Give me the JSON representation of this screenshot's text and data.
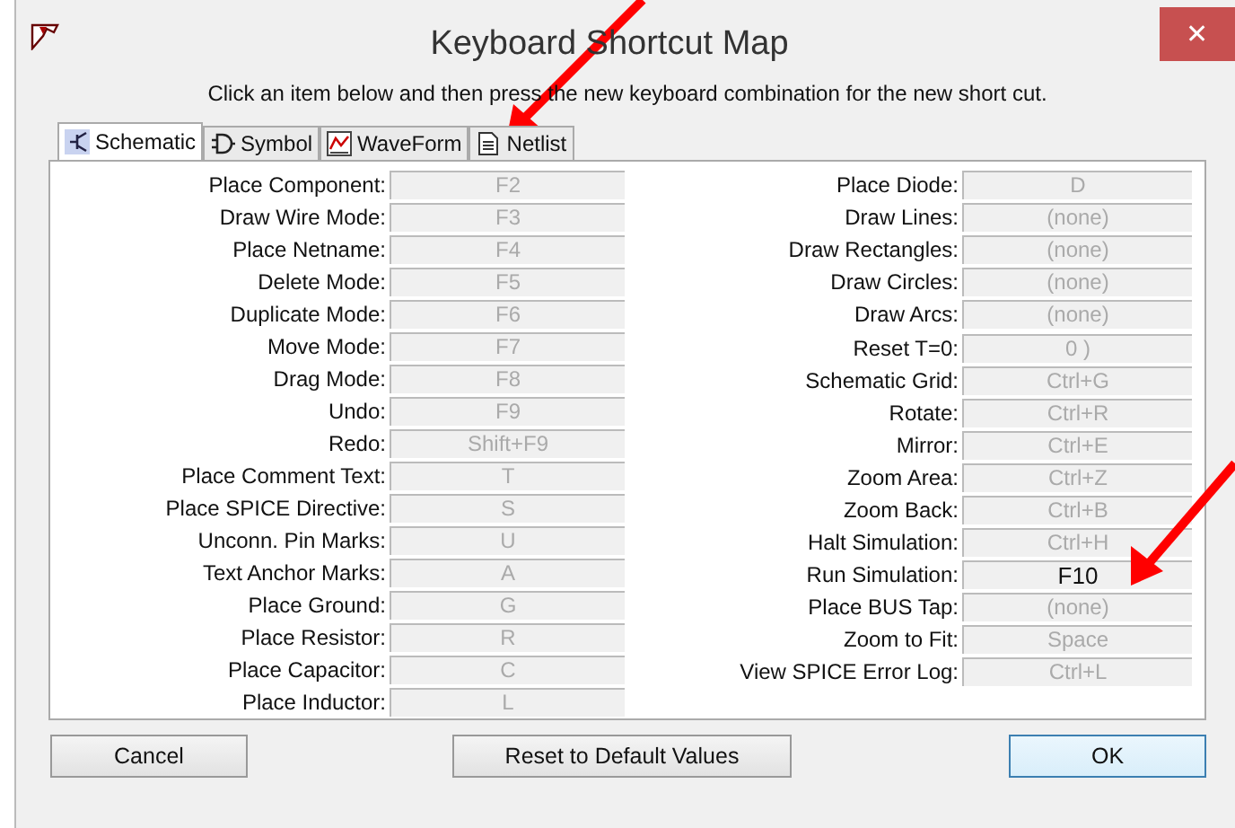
{
  "window": {
    "title": "Keyboard Shortcut Map",
    "close": "✕"
  },
  "instruction": "Click an item below and then press the new keyboard combination for the new short cut.",
  "tabs": [
    {
      "label": "Schematic",
      "selected": true
    },
    {
      "label": "Symbol",
      "selected": false
    },
    {
      "label": "WaveForm",
      "selected": false
    },
    {
      "label": "Netlist",
      "selected": false
    }
  ],
  "columns": [
    [
      {
        "label": "Place Component:",
        "key": "F2",
        "modified": false
      },
      {
        "label": "Draw Wire Mode:",
        "key": "F3",
        "modified": false
      },
      {
        "label": "Place Netname:",
        "key": "F4",
        "modified": false
      },
      {
        "label": "Delete Mode:",
        "key": "F5",
        "modified": false
      },
      {
        "label": "Duplicate Mode:",
        "key": "F6",
        "modified": false
      },
      {
        "label": "Move Mode:",
        "key": "F7",
        "modified": false
      },
      {
        "label": "Drag Mode:",
        "key": "F8",
        "modified": false
      },
      {
        "label": "Undo:",
        "key": "F9",
        "modified": false
      },
      {
        "label": "Redo:",
        "key": "Shift+F9",
        "modified": false
      },
      {
        "label": "Place Comment Text:",
        "key": "T",
        "modified": false
      },
      {
        "label": "Place SPICE Directive:",
        "key": "S",
        "modified": false
      },
      {
        "label": "Unconn. Pin Marks:",
        "key": "U",
        "modified": false
      },
      {
        "label": "Text Anchor Marks:",
        "key": "A",
        "modified": false
      },
      {
        "label": "Place Ground:",
        "key": "G",
        "modified": false
      },
      {
        "label": "Place Resistor:",
        "key": "R",
        "modified": false
      },
      {
        "label": "Place Capacitor:",
        "key": "C",
        "modified": false
      },
      {
        "label": "Place Inductor:",
        "key": "L",
        "modified": false
      }
    ],
    [
      {
        "label": "Place Diode:",
        "key": "D",
        "modified": false
      },
      {
        "label": "Draw Lines:",
        "key": "(none)",
        "modified": false
      },
      {
        "label": "Draw Rectangles:",
        "key": "(none)",
        "modified": false
      },
      {
        "label": "Draw Circles:",
        "key": "(none)",
        "modified": false
      },
      {
        "label": "Draw Arcs:",
        "key": "(none)",
        "modified": false
      },
      {
        "label": "Reset T=0:",
        "key": "0 )",
        "modified": false
      },
      {
        "label": "Schematic Grid:",
        "key": "Ctrl+G",
        "modified": false
      },
      {
        "label": "Rotate:",
        "key": "Ctrl+R",
        "modified": false
      },
      {
        "label": "Mirror:",
        "key": "Ctrl+E",
        "modified": false
      },
      {
        "label": "Zoom Area:",
        "key": "Ctrl+Z",
        "modified": false
      },
      {
        "label": "Zoom Back:",
        "key": "Ctrl+B",
        "modified": false
      },
      {
        "label": "Halt Simulation:",
        "key": "Ctrl+H",
        "modified": false
      },
      {
        "label": "Run Simulation:",
        "key": "F10",
        "modified": true
      },
      {
        "label": "Place BUS Tap:",
        "key": "(none)",
        "modified": false
      },
      {
        "label": "Zoom to Fit:",
        "key": "Space",
        "modified": false
      },
      {
        "label": "View SPICE Error Log:",
        "key": "Ctrl+L",
        "modified": false
      }
    ]
  ],
  "buttons": [
    {
      "label": "Cancel",
      "default": false
    },
    {
      "label": "Reset to Default Values",
      "default": false
    },
    {
      "label": "OK",
      "default": true
    }
  ]
}
